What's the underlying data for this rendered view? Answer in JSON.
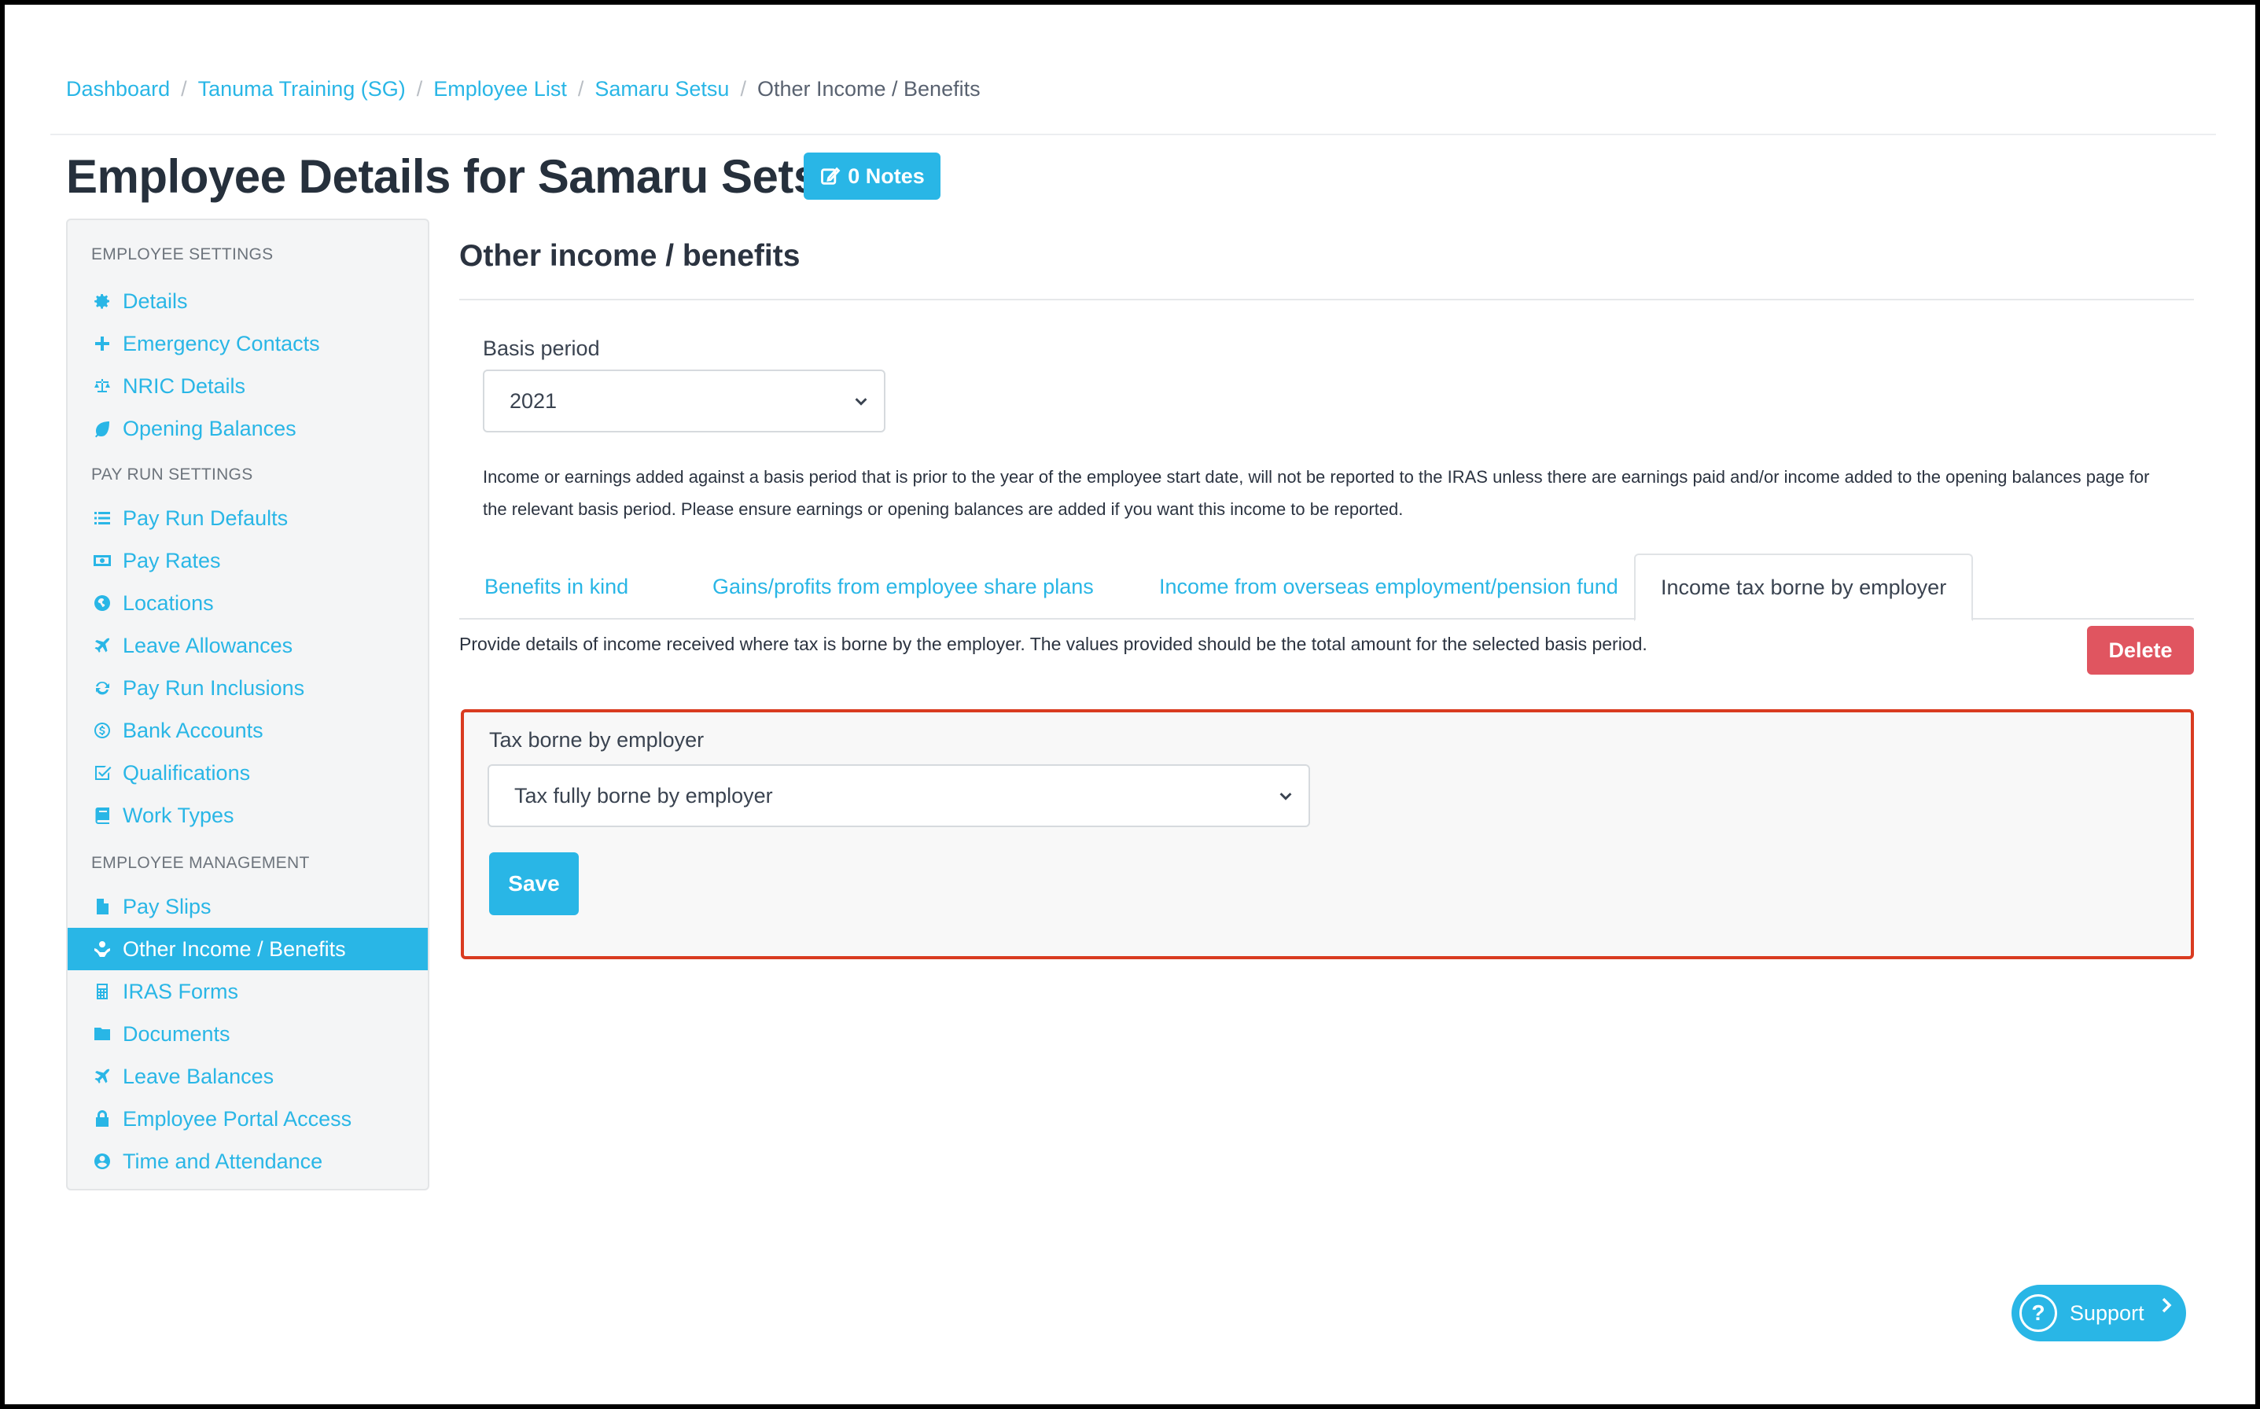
{
  "breadcrumb": {
    "items": [
      "Dashboard",
      "Tanuma Training (SG)",
      "Employee List",
      "Samaru Setsu"
    ],
    "current": "Other Income / Benefits"
  },
  "header": {
    "title": "Employee Details for Samaru Setsu",
    "notes_label": "0 Notes"
  },
  "sidebar": {
    "sections": [
      "EMPLOYEE SETTINGS",
      "PAY RUN SETTINGS",
      "EMPLOYEE MANAGEMENT"
    ],
    "items": [
      {
        "label": "Details",
        "icon": "gear-icon"
      },
      {
        "label": "Emergency Contacts",
        "icon": "plus-icon"
      },
      {
        "label": "NRIC Details",
        "icon": "balance-scale-icon"
      },
      {
        "label": "Opening Balances",
        "icon": "leaf-icon"
      },
      {
        "label": "Pay Run Defaults",
        "icon": "list-icon"
      },
      {
        "label": "Pay Rates",
        "icon": "money-icon"
      },
      {
        "label": "Locations",
        "icon": "globe-icon"
      },
      {
        "label": "Leave Allowances",
        "icon": "plane-icon"
      },
      {
        "label": "Pay Run Inclusions",
        "icon": "refresh-icon"
      },
      {
        "label": "Bank Accounts",
        "icon": "dollar-circle-icon"
      },
      {
        "label": "Qualifications",
        "icon": "check-square-icon"
      },
      {
        "label": "Work Types",
        "icon": "book-icon"
      },
      {
        "label": "Pay Slips",
        "icon": "file-icon"
      },
      {
        "label": "Other Income / Benefits",
        "icon": "hand-holding-icon"
      },
      {
        "label": "IRAS Forms",
        "icon": "calculator-icon"
      },
      {
        "label": "Documents",
        "icon": "folder-icon"
      },
      {
        "label": "Leave Balances",
        "icon": "plane-icon"
      },
      {
        "label": "Employee Portal Access",
        "icon": "lock-icon"
      },
      {
        "label": "Time and Attendance",
        "icon": "user-clock-icon"
      }
    ],
    "active": "Other Income / Benefits"
  },
  "main": {
    "section_title": "Other income / benefits",
    "basis_label": "Basis period",
    "basis_value": "2021",
    "info_text": "Income or earnings added against a basis period that is prior to the year of the employee start date, will not be reported to the IRAS unless there are earnings paid and/or income added to the opening balances page for the relevant basis period. Please ensure earnings or opening balances are added if you want this income to be reported.",
    "tabs": [
      "Benefits in kind",
      "Gains/profits from employee share plans",
      "Income from overseas employment/pension fund",
      "Income tax borne by employer"
    ],
    "active_tab": "Income tax borne by employer",
    "tab_description": "Provide details of income received where tax is borne by the employer. The values provided should be the total amount for the selected basis period.",
    "delete_label": "Delete",
    "form": {
      "label": "Tax borne by employer",
      "value": "Tax fully borne by employer",
      "save_label": "Save"
    }
  },
  "support": {
    "label": "Support"
  },
  "colors": {
    "accent": "#29b6e6",
    "danger": "#e05560",
    "highlight": "#d93b20"
  }
}
